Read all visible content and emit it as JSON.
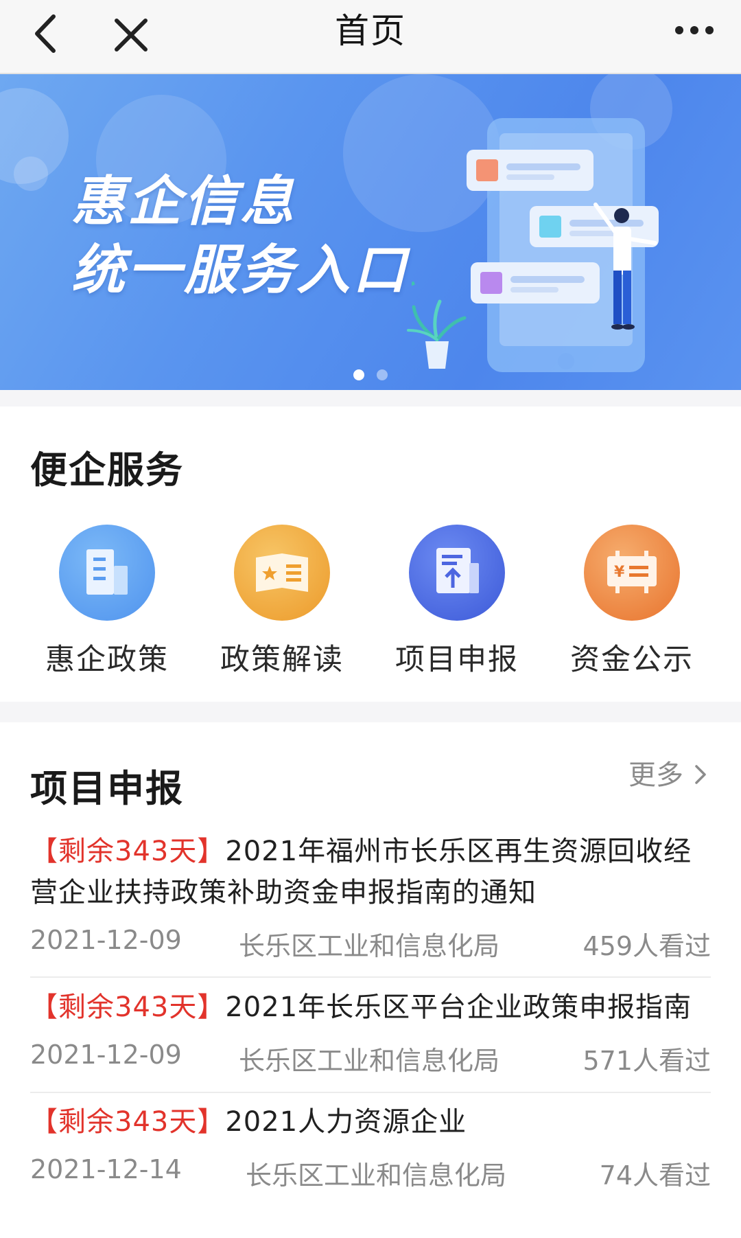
{
  "nav": {
    "back_icon": "chevron-left-icon",
    "close_icon": "close-icon",
    "title": "首页",
    "more_icon": "more-horizontal-icon"
  },
  "banner": {
    "line1": "惠企信息",
    "line2": "统一服务入口",
    "slide_count": 2,
    "active_slide": 1
  },
  "services": {
    "title": "便企服务",
    "items": [
      {
        "label": "惠企政策",
        "icon": "building-icon",
        "color": "#5b9ff2"
      },
      {
        "label": "政策解读",
        "icon": "policy-book-icon",
        "color": "#f1a93c"
      },
      {
        "label": "项目申报",
        "icon": "document-upload-icon",
        "color": "#4f6ee8"
      },
      {
        "label": "资金公示",
        "icon": "money-board-icon",
        "color": "#ef8e45"
      }
    ]
  },
  "projects": {
    "title": "项目申报",
    "more_label": "更多",
    "items": [
      {
        "tag": "【剩余343天】",
        "title": "2021年福州市长乐区再生资源回收经营企业扶持政策补助资金申报指南的通知",
        "date": "2021-12-09",
        "dept": "长乐区工业和信息化局",
        "views": "459人看过"
      },
      {
        "tag": "【剩余343天】",
        "title": "2021年长乐区平台企业政策申报指南",
        "date": "2021-12-09",
        "dept": "长乐区工业和信息化局",
        "views": "571人看过"
      },
      {
        "tag": "【剩余343天】",
        "title": "2021人力资源企业",
        "date": "2021-12-14",
        "dept": "长乐区工业和信息化局",
        "views": "74人看过"
      }
    ]
  },
  "colors": {
    "accent_red": "#e2332b",
    "banner_blue": "#5a95ef",
    "meta_gray": "#8a8a8a"
  }
}
